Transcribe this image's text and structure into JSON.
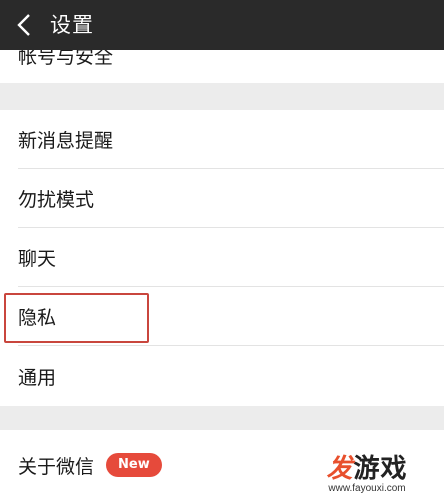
{
  "header": {
    "title": "设置",
    "back_icon": "chevron-left-icon"
  },
  "sections": {
    "top": {
      "account_label": "帐号与安全"
    },
    "main": [
      {
        "label": "新消息提醒"
      },
      {
        "label": "勿扰模式"
      },
      {
        "label": "聊天"
      },
      {
        "label": "隐私"
      },
      {
        "label": "通用"
      }
    ],
    "bottom": {
      "about_label": "关于微信",
      "badge": "New"
    }
  },
  "colors": {
    "topbar": "#2a2a2a",
    "badge": "#e64a3b",
    "highlight": "#c9463d",
    "background": "#ececec"
  },
  "watermark": {
    "logo_a": "发",
    "logo_b": "游戏",
    "url": "www.fayouxi.com"
  }
}
